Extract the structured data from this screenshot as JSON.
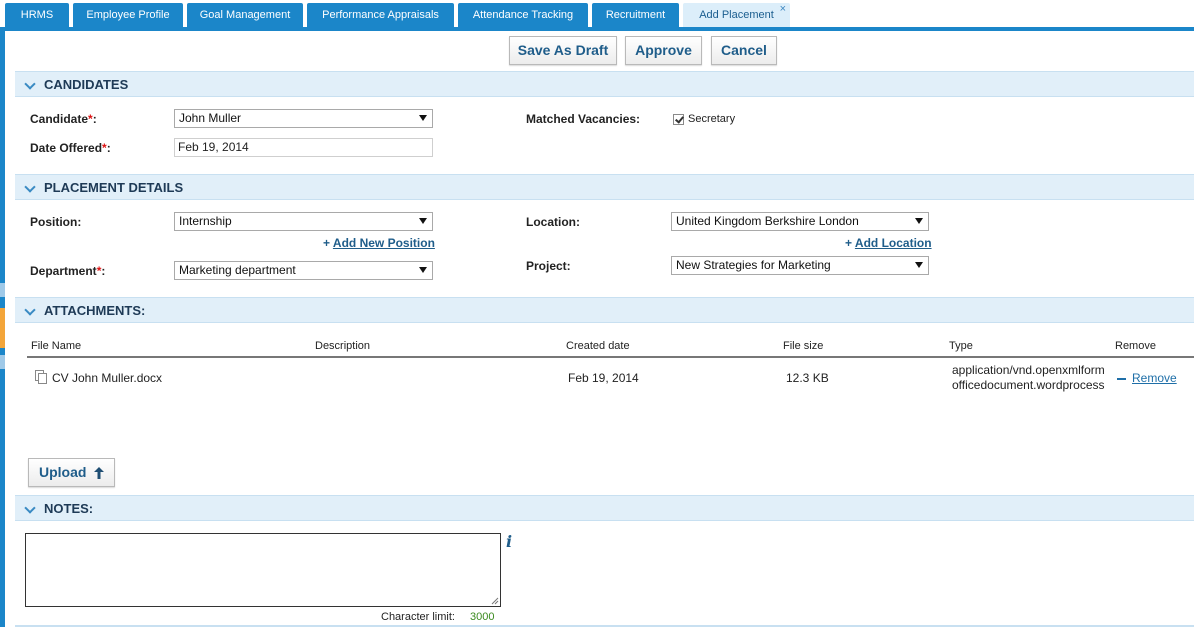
{
  "tabs": [
    {
      "label": "HRMS"
    },
    {
      "label": "Employee Profile"
    },
    {
      "label": "Goal Management"
    },
    {
      "label": "Performance Appraisals"
    },
    {
      "label": "Attendance Tracking"
    },
    {
      "label": "Recruitment"
    },
    {
      "label": "Add Placement",
      "close": "×"
    }
  ],
  "toolbar": {
    "save_draft": "Save As Draft",
    "approve": "Approve",
    "cancel": "Cancel"
  },
  "candidates": {
    "title": "CANDIDATES",
    "candidate_label": "Candidate",
    "candidate_value": "John Muller",
    "date_label": "Date Offered",
    "date_value": "Feb 19, 2014",
    "required_mark": "*",
    "colon": ":",
    "matched_label": "Matched Vacancies:",
    "matched_value": "Secretary"
  },
  "placement": {
    "title": "PLACEMENT DETAILS",
    "position_label": "Position:",
    "position_value": "Internship",
    "add_position_plus": "+",
    "add_position": "Add New Position",
    "department_label": "Department",
    "department_value": "Marketing department",
    "location_label": "Location:",
    "location_value": "United Kingdom Berkshire London",
    "add_location_plus": "+",
    "add_location": "Add Location",
    "project_label": "Project:",
    "project_value": "New Strategies for Marketing"
  },
  "attachments": {
    "title": "ATTACHMENTS:",
    "columns": [
      "File Name",
      "Description",
      "Created date",
      "File size",
      "Type",
      "Remove"
    ],
    "rows": [
      {
        "file_name": "CV John Muller.docx",
        "description": "",
        "created": "Feb 19, 2014",
        "size": "12.3 KB",
        "type_line1": "application/vnd.openxmlform",
        "type_line2": "officedocument.wordprocess",
        "remove": "Remove"
      }
    ],
    "upload": "Upload"
  },
  "notes": {
    "title": "NOTES:",
    "char_limit_label": "Character limit:",
    "char_limit_value": "3000"
  },
  "colors": {
    "tab_blue": "#1b86c9",
    "section_bg": "#e1eff9",
    "link_blue": "#1f5d8a",
    "required_red": "#dd1111",
    "char_green": "#3a8a1e"
  }
}
